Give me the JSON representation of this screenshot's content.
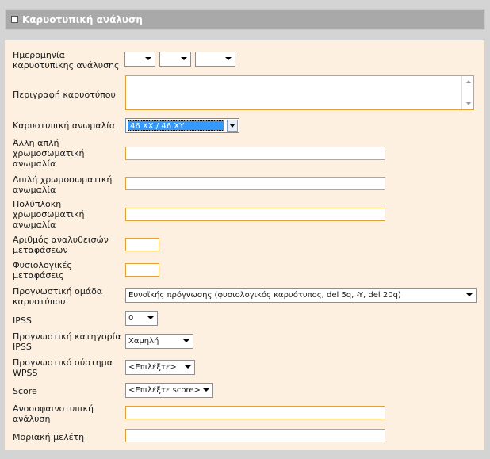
{
  "section": {
    "title": "Καρυοτυπική ανάλυση"
  },
  "date": {
    "label": "Ημερομηνία καρυοτυπικης ανάλυσης",
    "day": "",
    "month": "",
    "year": ""
  },
  "description": {
    "label": "Περιγραφή καρυοτύπου",
    "value": ""
  },
  "karyo_anomaly": {
    "label": "Καρυοτυπική ανωμαλία",
    "value": "46 XX / 46 XY"
  },
  "simple_anomaly": {
    "label": "Άλλη απλή χρωμοσωματική ανωμαλία",
    "value": ""
  },
  "double_anomaly": {
    "label": "Διπλή χρωμοσωματική ανωμαλία",
    "value": ""
  },
  "complex_anomaly": {
    "label": "Πολύπλοκη χρωμοσωματική ανωμαλία",
    "value": ""
  },
  "analyzed_metaphases": {
    "label": "Αριθμός αναλυθεισών μεταφάσεων",
    "value": ""
  },
  "normal_metaphases": {
    "label": "Φυσιολογικές μεταφάσεις",
    "value": ""
  },
  "prognostic_group": {
    "label": "Προγνωστική ομάδα καρυοτύπου",
    "value": "Ευνοϊκής πρόγνωσης (φυσιολογικός καρυότυπος, del 5q, -Y, del 20q)"
  },
  "ipss": {
    "label": "IPSS",
    "value": "0"
  },
  "ipss_category": {
    "label": "Προγνωστική κατηγορία IPSS",
    "value": "Χαμηλή"
  },
  "wpss": {
    "label": "Προγνωστικό σύστημα WPSS",
    "value": "<Επιλέξτε>"
  },
  "score": {
    "label": "Score",
    "value": "<Επιλέξτε score>"
  },
  "immuno": {
    "label": "Ανοσοφαινοτυπική ανάλυση",
    "value": ""
  },
  "molecular": {
    "label": "Μοριακή μελέτη",
    "value": ""
  }
}
